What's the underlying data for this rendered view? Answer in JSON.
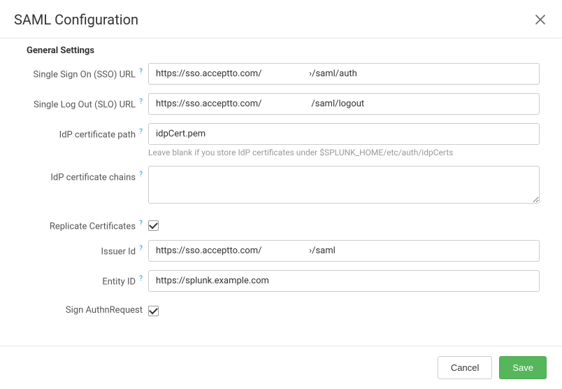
{
  "modal": {
    "title": "SAML Configuration"
  },
  "section": {
    "general": "General Settings"
  },
  "fields": {
    "sso_url": {
      "label": "Single Sign On (SSO) URL",
      "value": "https://sso.acceptto.com/                     ›/saml/auth"
    },
    "slo_url": {
      "label": "Single Log Out (SLO) URL",
      "value": "https://sso.acceptto.com/                      /saml/logout"
    },
    "idp_cert_path": {
      "label": "IdP certificate path",
      "value": "idpCert.pem",
      "hint": "Leave blank if you store IdP certificates under $SPLUNK_HOME/etc/auth/idpCerts"
    },
    "idp_cert_chains": {
      "label": "IdP certificate chains",
      "value": ""
    },
    "replicate_certs": {
      "label": "Replicate Certificates",
      "checked": true
    },
    "issuer_id": {
      "label": "Issuer Id",
      "value": "https://sso.acceptto.com/                     ›/saml"
    },
    "entity_id": {
      "label": "Entity ID",
      "value": "https://splunk.example.com"
    },
    "sign_authn": {
      "label": "Sign AuthnRequest",
      "checked": true
    }
  },
  "buttons": {
    "cancel": "Cancel",
    "save": "Save"
  },
  "help_marker": "?"
}
